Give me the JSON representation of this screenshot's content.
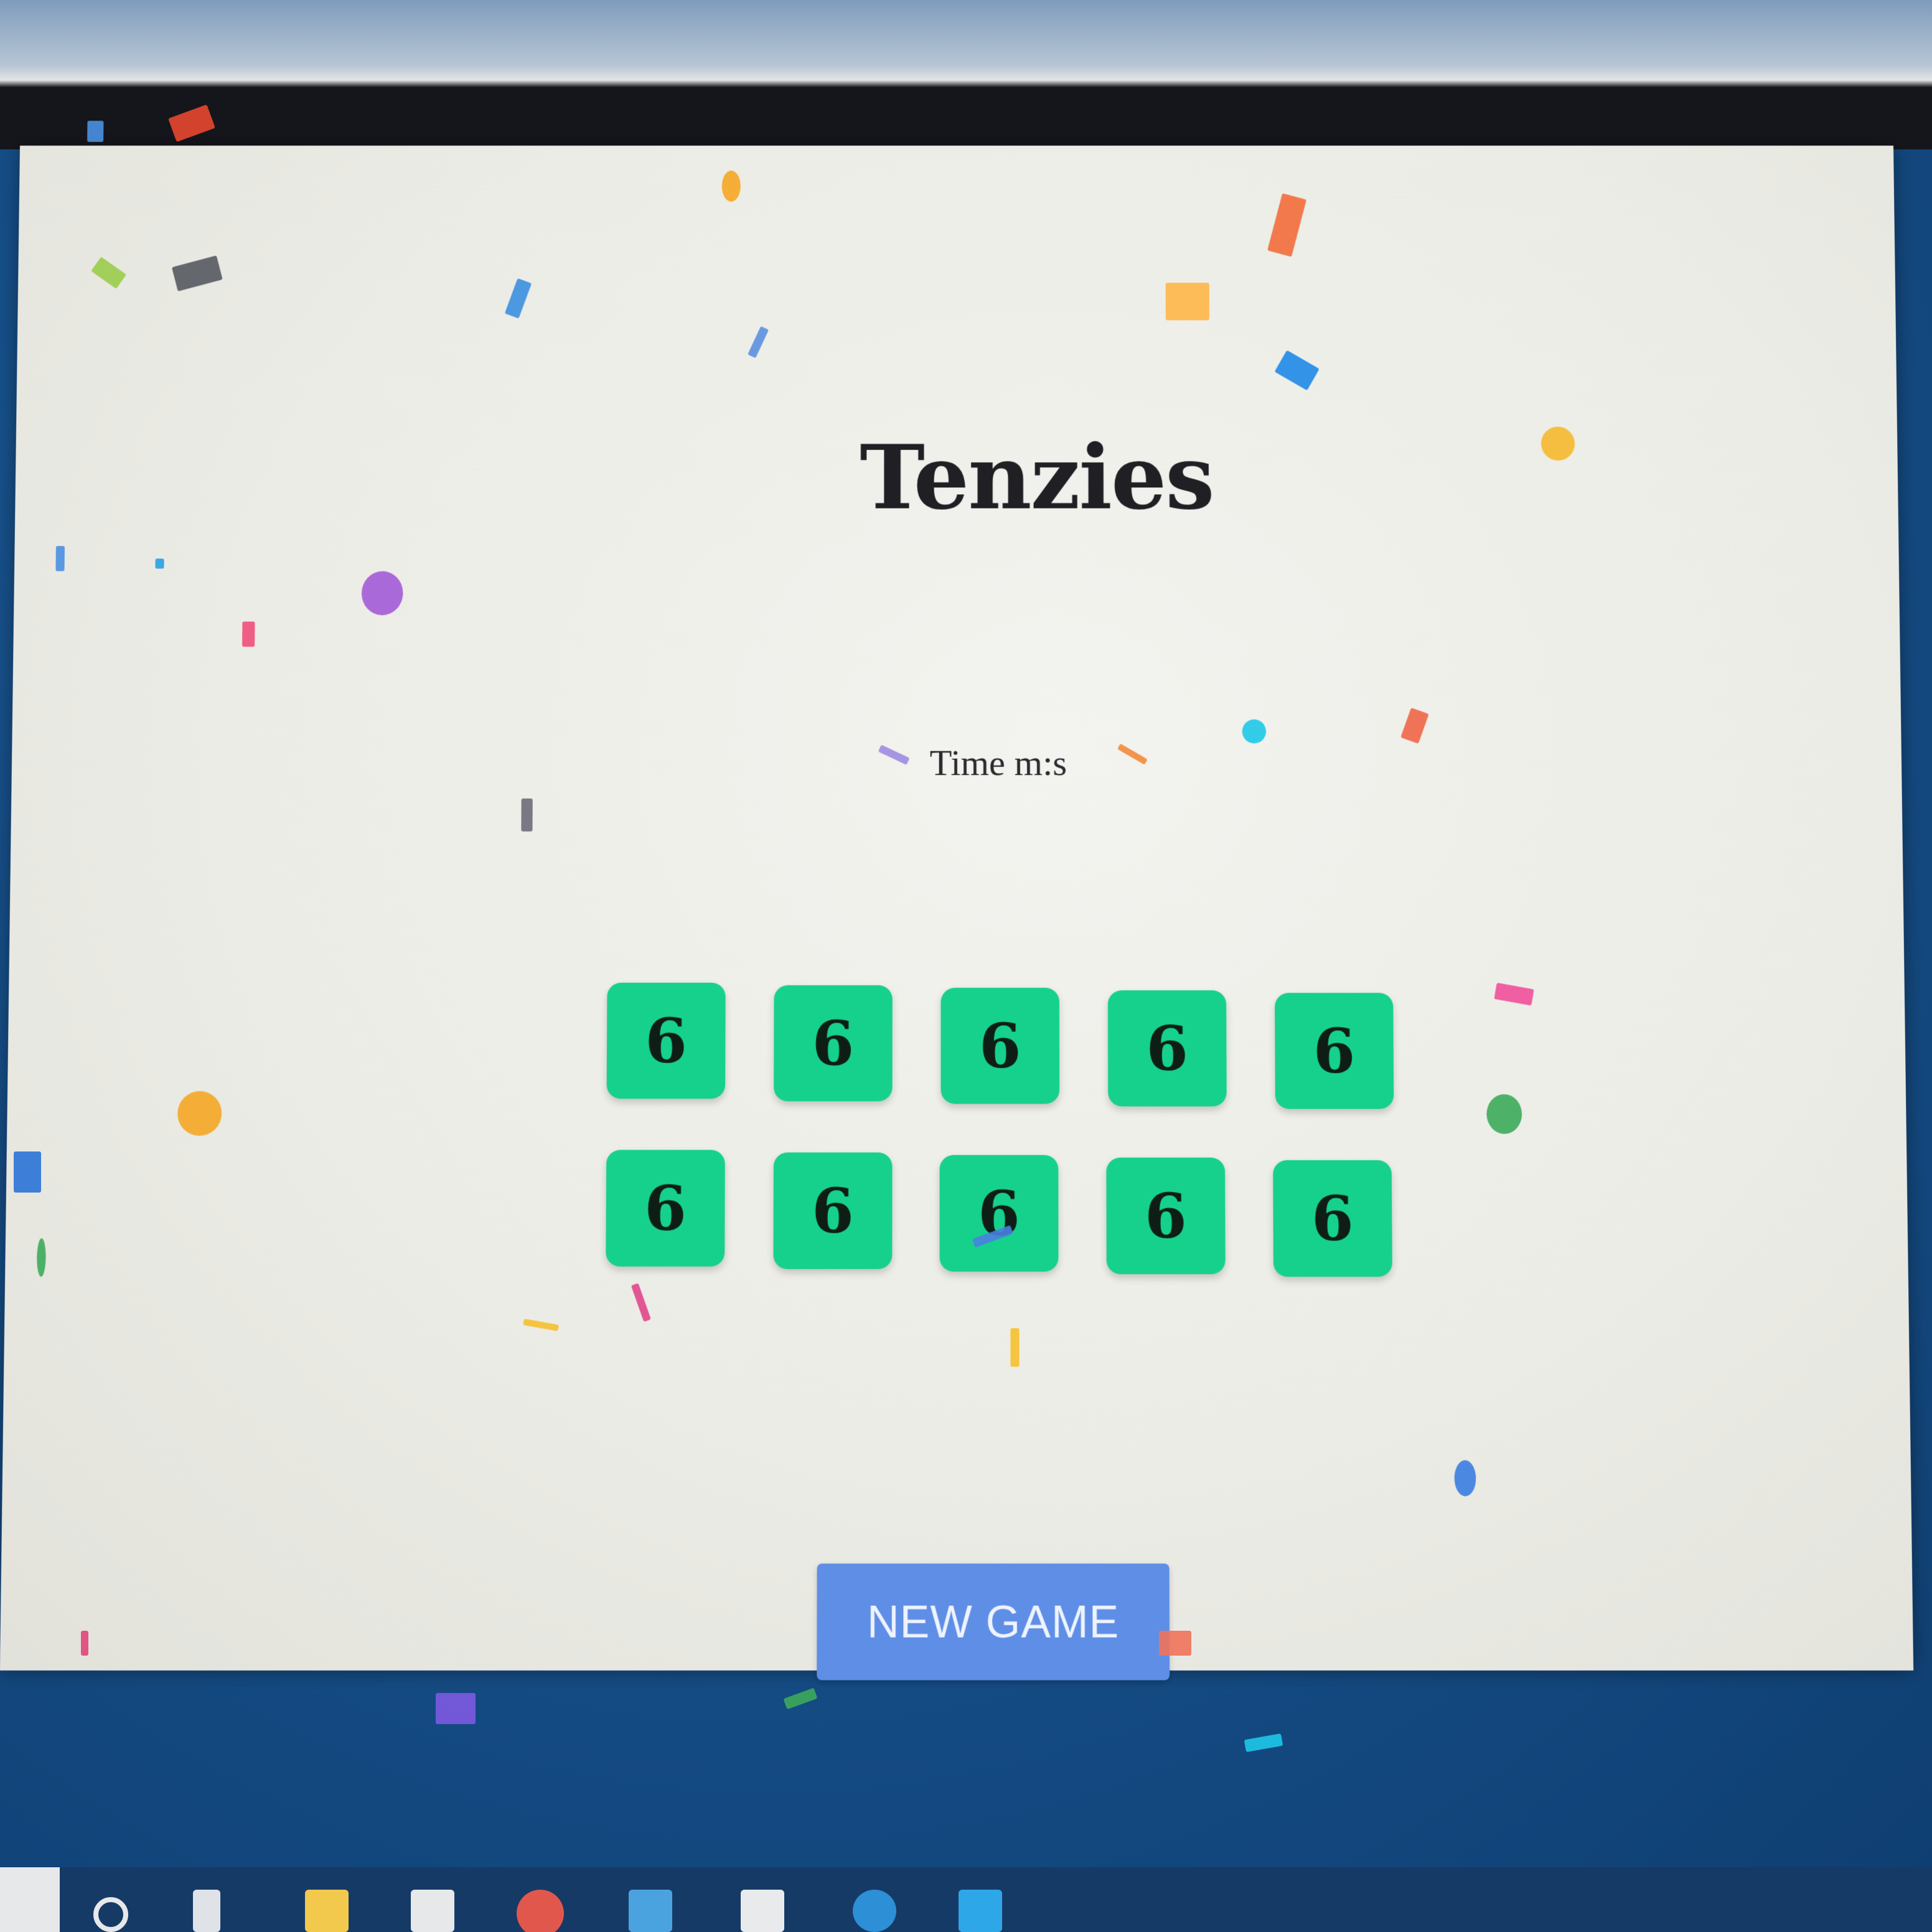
{
  "game": {
    "title": "Tenzies",
    "time_label": "Time m:s",
    "dice": [
      "6",
      "6",
      "6",
      "6",
      "6",
      "6",
      "6",
      "6",
      "6",
      "6"
    ],
    "new_game_label": "NEW GAME"
  },
  "colors": {
    "die_held": "#16d18c",
    "button": "#5f8ee6",
    "page_background": "#ececE6",
    "desktop": "#16508a"
  },
  "taskbar": {
    "icons": [
      "search-circle-icon",
      "task-view-icon",
      "file-explorer-icon",
      "mail-icon",
      "chrome-icon",
      "app-icon",
      "store-icon",
      "edge-icon",
      "vscode-icon"
    ]
  }
}
